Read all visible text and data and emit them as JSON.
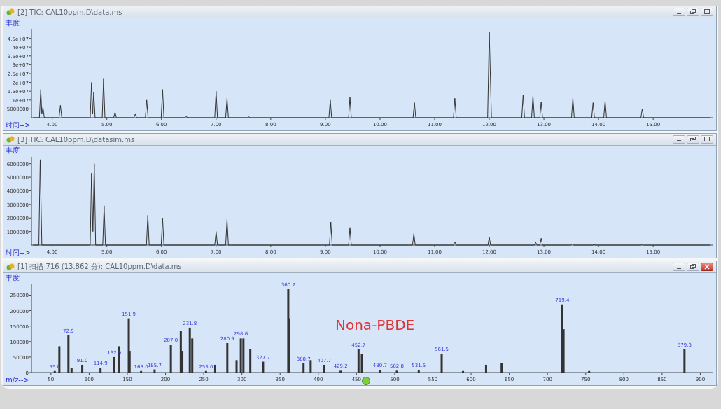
{
  "panels": [
    {
      "title": "[2] TIC: CAL10ppm.D\\data.ms",
      "buttons": [
        {
          "kind": "minimize"
        },
        {
          "kind": "restore"
        },
        {
          "kind": "maximize"
        }
      ],
      "chart_data": {
        "type": "line",
        "xlabel": "时间-->",
        "ylabel": "丰度",
        "xlim": [
          3.62,
          16.1
        ],
        "ylim": [
          0,
          50000000
        ],
        "x": [
          3.65,
          3.765,
          3.79,
          3.81,
          3.83,
          3.855,
          4.125,
          4.15,
          4.175,
          4.695,
          4.72,
          4.74,
          4.76,
          4.785,
          4.915,
          4.94,
          4.965,
          5.125,
          5.15,
          5.175,
          5.495,
          5.52,
          5.545,
          5.705,
          5.73,
          5.755,
          5.995,
          6.02,
          6.045,
          6.425,
          6.45,
          6.475,
          6.975,
          7.0,
          7.025,
          7.175,
          7.2,
          7.225,
          7.575,
          7.6,
          7.625,
          9.065,
          9.09,
          9.115,
          9.425,
          9.45,
          9.475,
          10.605,
          10.63,
          10.655,
          11.345,
          11.37,
          11.395,
          11.97,
          12.0,
          12.04,
          12.595,
          12.62,
          12.645,
          12.775,
          12.8,
          12.825,
          12.925,
          12.95,
          12.975,
          13.505,
          13.53,
          13.555,
          13.875,
          13.9,
          13.925,
          14.095,
          14.12,
          14.145,
          14.775,
          14.8,
          14.825,
          16.05
        ],
        "values": [
          0,
          0,
          16000000,
          2000000,
          6000000,
          0,
          0,
          7000000,
          0,
          0,
          20000000,
          2000000,
          14500000,
          0,
          0,
          22000000,
          0,
          0,
          3000000,
          0,
          0,
          2000000,
          0,
          0,
          10000000,
          0,
          0,
          16000000,
          0,
          0,
          1000000,
          0,
          0,
          15000000,
          0,
          0,
          11000000,
          0,
          0,
          500000,
          0,
          0,
          10000000,
          0,
          0,
          11500000,
          0,
          0,
          8500000,
          0,
          0,
          11000000,
          0,
          0,
          48500000,
          0,
          0,
          13000000,
          0,
          0,
          12500000,
          0,
          0,
          9000000,
          0,
          0,
          11000000,
          0,
          0,
          8500000,
          0,
          0,
          9500000,
          0,
          0,
          5000000,
          0,
          0
        ],
        "xticks": [
          {
            "value": 4,
            "label": "4.00"
          },
          {
            "value": 5,
            "label": "5.00"
          },
          {
            "value": 6,
            "label": "6.00"
          },
          {
            "value": 7,
            "label": "7.00"
          },
          {
            "value": 8,
            "label": "8.00"
          },
          {
            "value": 9,
            "label": "9.00"
          },
          {
            "value": 10,
            "label": "10.00"
          },
          {
            "value": 11,
            "label": "11.00"
          },
          {
            "value": 12,
            "label": "12.00"
          },
          {
            "value": 13,
            "label": "13.00"
          },
          {
            "value": 14,
            "label": "14.00"
          },
          {
            "value": 15,
            "label": "15.00"
          }
        ],
        "yticks": [
          5000000,
          {
            "value": 10000000,
            "label": "1e+07"
          },
          {
            "value": 15000000,
            "label": "1.5e+07"
          },
          {
            "value": 20000000,
            "label": "2e+07"
          },
          {
            "value": 25000000,
            "label": "2.5e+07"
          },
          {
            "value": 30000000,
            "label": "3e+07"
          },
          {
            "value": 35000000,
            "label": "3.5e+07"
          },
          {
            "value": 40000000,
            "label": "4e+07"
          },
          {
            "value": 45000000,
            "label": "4.5e+07"
          }
        ]
      }
    },
    {
      "title": "[3] TIC: CAL10ppm.D\\datasim.ms",
      "buttons": [
        {
          "kind": "minimize"
        },
        {
          "kind": "restore"
        },
        {
          "kind": "maximize"
        }
      ],
      "chart_data": {
        "type": "line",
        "xlabel": "时间-->",
        "ylabel": "丰度",
        "xlim": [
          3.62,
          16.1
        ],
        "ylim": [
          0,
          6500000
        ],
        "x": [
          3.65,
          3.755,
          3.78,
          3.81,
          4.695,
          4.72,
          4.745,
          4.77,
          4.795,
          4.925,
          4.95,
          4.975,
          5.725,
          5.75,
          5.775,
          5.995,
          6.02,
          6.045,
          6.975,
          7.0,
          7.025,
          7.175,
          7.2,
          7.225,
          9.075,
          9.1,
          9.125,
          9.425,
          9.45,
          9.475,
          10.595,
          10.62,
          10.645,
          11.345,
          11.37,
          11.395,
          11.975,
          12.0,
          12.025,
          12.825,
          12.85,
          12.875,
          12.925,
          12.95,
          12.975,
          13.495,
          13.52,
          13.545,
          13.895,
          13.92,
          13.945,
          14.775,
          14.8,
          14.825,
          16.05
        ],
        "values": [
          0,
          0,
          6300000,
          0,
          0,
          5300000,
          1000000,
          6000000,
          0,
          0,
          2900000,
          0,
          0,
          2200000,
          0,
          0,
          2000000,
          0,
          0,
          1000000,
          0,
          0,
          1900000,
          0,
          0,
          1700000,
          0,
          0,
          1300000,
          0,
          0,
          850000,
          0,
          0,
          250000,
          0,
          0,
          600000,
          0,
          0,
          200000,
          0,
          0,
          500000,
          0,
          0,
          100000,
          0,
          0,
          50000,
          0,
          0,
          50000,
          0,
          0
        ],
        "xticks": [
          {
            "value": 4,
            "label": "4.00"
          },
          {
            "value": 5,
            "label": "5.00"
          },
          {
            "value": 6,
            "label": "6.00"
          },
          {
            "value": 7,
            "label": "7.00"
          },
          {
            "value": 8,
            "label": "8.00"
          },
          {
            "value": 9,
            "label": "9.00"
          },
          {
            "value": 10,
            "label": "10.00"
          },
          {
            "value": 11,
            "label": "11.00"
          },
          {
            "value": 12,
            "label": "12.00"
          },
          {
            "value": 13,
            "label": "13.00"
          },
          {
            "value": 14,
            "label": "14.00"
          },
          {
            "value": 15,
            "label": "15.00"
          }
        ],
        "yticks": [
          1000000,
          2000000,
          3000000,
          4000000,
          5000000,
          6000000
        ]
      }
    },
    {
      "title": "[1] 扫描 716 (13.862 分): CAL10ppm.D\\data.ms",
      "note": "Nona-PBDE",
      "buttons": [
        {
          "kind": "minimize"
        },
        {
          "kind": "restore"
        },
        {
          "kind": "close"
        }
      ],
      "chart_data": {
        "type": "bar",
        "xlabel": "m/z-->",
        "ylabel": "丰度",
        "xlim": [
          24.5,
          917
        ],
        "ylim": [
          0,
          285000
        ],
        "x": [
          55,
          61,
          72.9,
          77,
          91,
          114.9,
          132.9,
          139,
          151.9,
          153,
          168,
          185.7,
          207,
          220,
          222,
          231.8,
          235,
          253,
          265,
          280.9,
          293,
          298.6,
          302,
          311,
          327.7,
          360.7,
          362,
          380.7,
          390,
          407.7,
          429.2,
          452.7,
          457,
          480.7,
          502.8,
          531.5,
          561.5,
          589.4,
          619.6,
          640,
          719.4,
          721,
          754.5,
          879.3
        ],
        "values": [
          5000,
          85000,
          120000,
          15000,
          25000,
          15000,
          50000,
          85000,
          175000,
          70000,
          5000,
          10000,
          90000,
          135000,
          70000,
          145000,
          110000,
          5000,
          25000,
          95000,
          40000,
          110000,
          110000,
          75000,
          35000,
          270000,
          175000,
          30000,
          40000,
          25000,
          6000,
          75000,
          60000,
          8000,
          6000,
          8000,
          60000,
          5000,
          25000,
          30000,
          220000,
          140000,
          5000,
          75000
        ],
        "xticks": [
          50,
          100,
          150,
          200,
          250,
          300,
          350,
          400,
          450,
          500,
          550,
          600,
          650,
          700,
          750,
          800,
          850,
          900
        ],
        "yticks": [
          0,
          50000,
          100000,
          150000,
          200000,
          250000
        ],
        "annotations": [
          {
            "x": 55,
            "y": 5000,
            "text": "55.0"
          },
          {
            "x": 72.9,
            "y": 120000,
            "text": "72.9"
          },
          {
            "x": 91,
            "y": 25000,
            "text": "91.0"
          },
          {
            "x": 114.9,
            "y": 15000,
            "text": "114.9"
          },
          {
            "x": 132.9,
            "y": 50000,
            "text": "132.9"
          },
          {
            "x": 151.9,
            "y": 175000,
            "text": "151.9"
          },
          {
            "x": 168,
            "y": 5000,
            "text": "168.0"
          },
          {
            "x": 185.7,
            "y": 10000,
            "text": "185.7"
          },
          {
            "x": 207,
            "y": 90000,
            "text": "207.0"
          },
          {
            "x": 231.8,
            "y": 145000,
            "text": "231.8"
          },
          {
            "x": 253,
            "y": 5000,
            "text": "253.0"
          },
          {
            "x": 280.9,
            "y": 95000,
            "text": "280.9"
          },
          {
            "x": 298.6,
            "y": 110000,
            "text": "298.6"
          },
          {
            "x": 327.7,
            "y": 35000,
            "text": "327.7"
          },
          {
            "x": 360.7,
            "y": 270000,
            "text": "360.7"
          },
          {
            "x": 380.7,
            "y": 30000,
            "text": "380.7"
          },
          {
            "x": 407.7,
            "y": 25000,
            "text": "407.7"
          },
          {
            "x": 429.2,
            "y": 6000,
            "text": "429.2"
          },
          {
            "x": 452.7,
            "y": 75000,
            "text": "452.7"
          },
          {
            "x": 480.7,
            "y": 8000,
            "text": "480.7"
          },
          {
            "x": 502.8,
            "y": 6000,
            "text": "502.8"
          },
          {
            "x": 531.5,
            "y": 8000,
            "text": "531.5"
          },
          {
            "x": 561.5,
            "y": 60000,
            "text": "561.5"
          },
          {
            "x": 719.4,
            "y": 220000,
            "text": "719.4"
          },
          {
            "x": 879.3,
            "y": 75000,
            "text": "879.3"
          }
        ]
      }
    }
  ]
}
